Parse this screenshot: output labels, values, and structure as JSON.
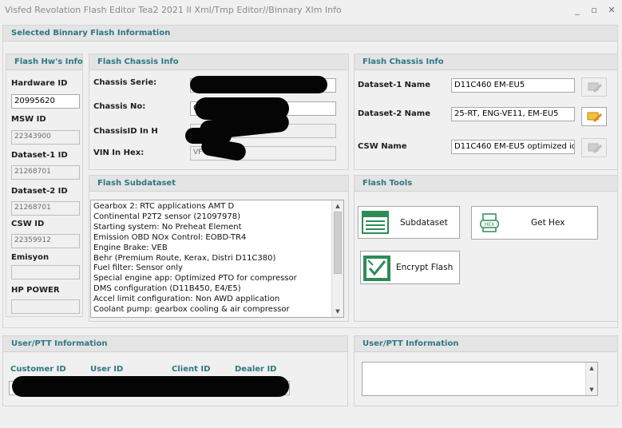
{
  "window": {
    "title": "Visfed Revolation Flash Editor Tea2 2021 II Xml/Tmp Editor//Binnary Xlm Info",
    "minimize": "_",
    "maximize": "▫",
    "close": "✕"
  },
  "main_header": "Selected Binnary Flash Information",
  "hw_panel": {
    "title": "Flash Hw's Info",
    "hardware_id_label": "Hardware ID",
    "hardware_id_value": "20995620",
    "msw_id_label": "MSW ID",
    "msw_id_value": "22343900",
    "dataset1_id_label": "Dataset-1 ID",
    "dataset1_id_value": "21268701",
    "dataset2_id_label": "Dataset-2 ID",
    "dataset2_id_value": "21268701",
    "csw_id_label": "CSW ID",
    "csw_id_value": "22359912",
    "emisyon_label": "Emisyon",
    "emisyon_value": "",
    "hp_power_label": "HP POWER",
    "hp_power_value": ""
  },
  "chassis_panel": {
    "title": "Flash Chassis Info",
    "serie_label": "Chassis Serie:",
    "no_label": "Chassis No:",
    "no_value_visible": "0",
    "chassis_id_label": "ChassisID In H",
    "vin_label": "VIN In Hex:",
    "vin_value_visible": "VF"
  },
  "dataset_panel": {
    "title": "Flash Chassis Info",
    "dataset1_label": "Dataset-1 Name",
    "dataset1_value": "D11C460 EM-EU5",
    "dataset2_label": "Dataset-2 Name",
    "dataset2_value": "25-RT, ENG-VE11, EM-EU5",
    "csw_label": "CSW Name",
    "csw_value": "D11C460 EM-EU5 optimized idle"
  },
  "subdataset_panel": {
    "title": "Flash Subdataset",
    "items": [
      "Gearbox 2: RTC applications AMT D",
      "Continental P2T2 sensor (21097978)",
      "Starting system: No Preheat Element",
      "Emission OBD NOx Control: EOBD-TR4",
      "Engine Brake: VEB",
      "Behr (Premium Route, Kerax, Distri D11C380)",
      "Fuel filter: Sensor only",
      "Special engine app: Optimized PTO for compressor",
      "DMS configuration (D11B450, E4/E5)",
      "Accel limit configuration: Non AWD application",
      "Coolant pump: gearbox cooling & air compressor"
    ]
  },
  "tools_panel": {
    "title": "Flash Tools",
    "subdataset_button": "Subdataset",
    "get_hex_button": "Get  Hex",
    "encrypt_button": "Encrypt Flash"
  },
  "user_panel": {
    "title": "User/PTT Information",
    "customer_id_label": "Customer ID",
    "user_id_label": "User ID",
    "client_id_label": "Client ID",
    "dealer_id_label": "Dealer ID",
    "first_char_visible": "5"
  },
  "user_panel2": {
    "title": "User/PTT Information",
    "notes_value": ""
  },
  "colors": {
    "accent": "#2e7784",
    "panel_header": "#e4e4e4",
    "window_bg": "#f0f0f0",
    "icon_green": "#2e8b57",
    "icon_orange": "#e0a020"
  }
}
